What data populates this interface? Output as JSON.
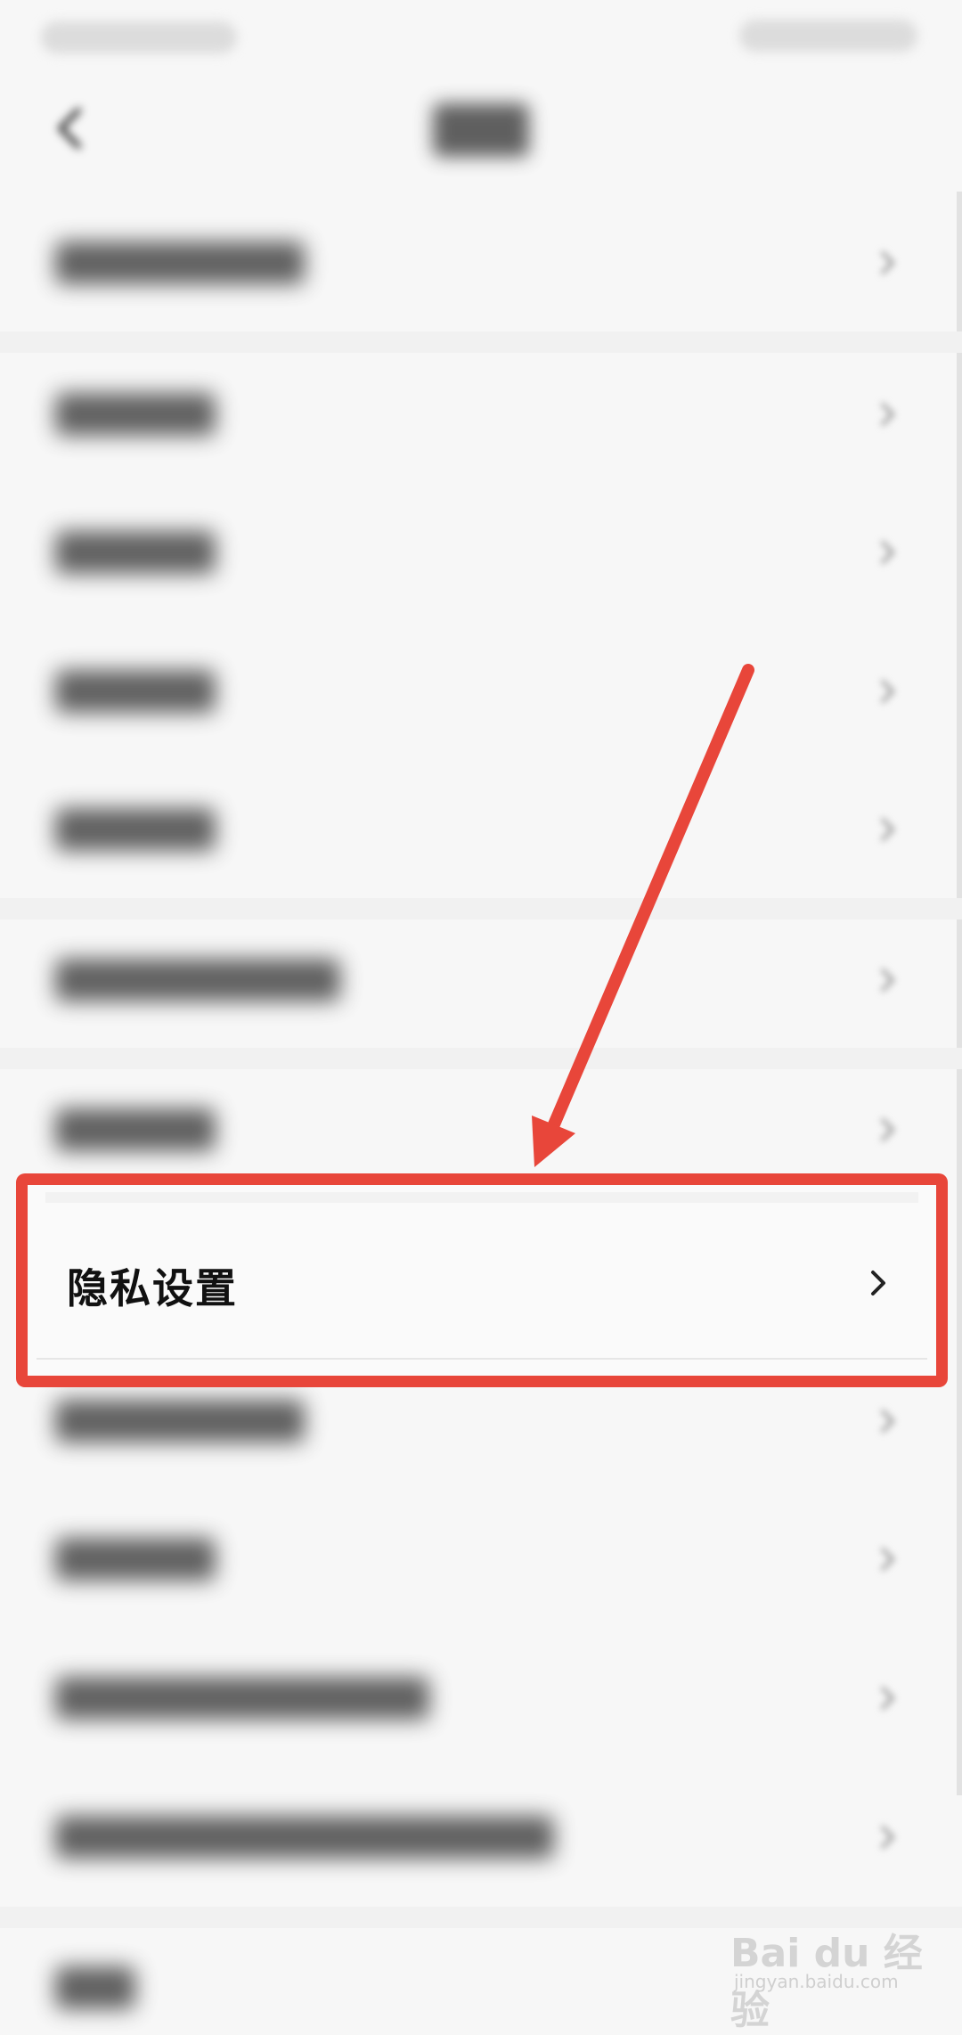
{
  "highlighted_item": {
    "label": "隐私设置"
  },
  "colors": {
    "highlight_border": "#e8463a",
    "arrow": "#e8463a",
    "background": "#f7f7f7",
    "label_text": "#111111"
  },
  "icons": {
    "back": "back-arrow-icon",
    "chevron": "chevron-right-icon"
  },
  "watermark": {
    "text": "Bai du 经验",
    "sub": "jingyan.baidu.com"
  }
}
